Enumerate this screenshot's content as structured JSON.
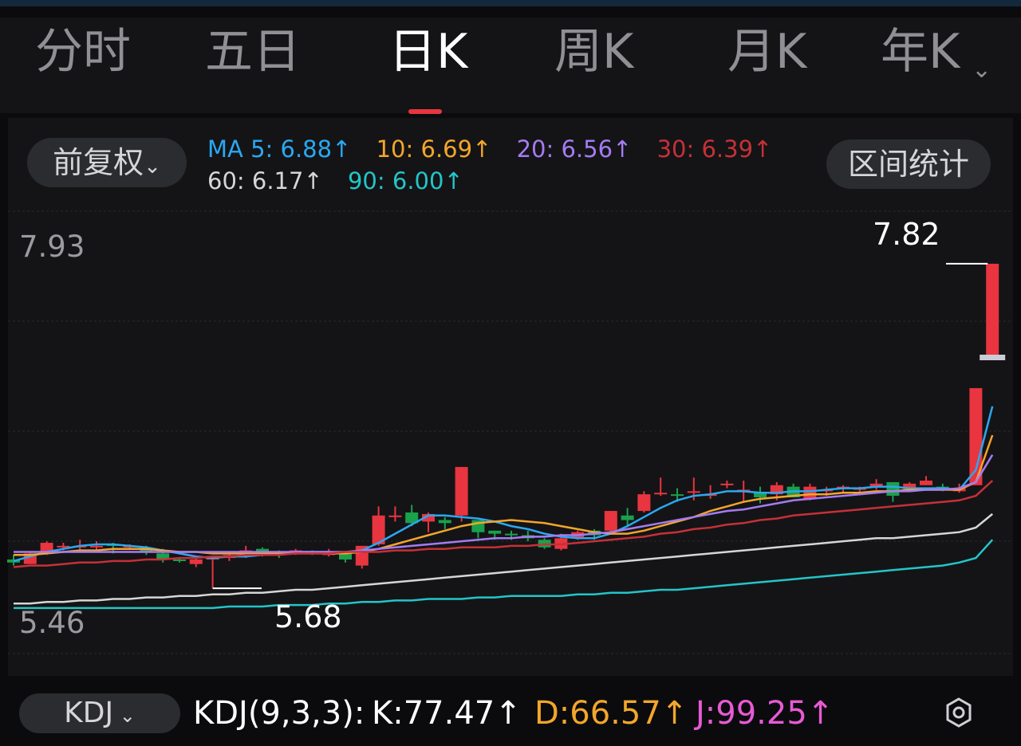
{
  "tabs": [
    {
      "label": "分时",
      "active": false
    },
    {
      "label": "五日",
      "active": false
    },
    {
      "label": "日K",
      "active": true
    },
    {
      "label": "周K",
      "active": false
    },
    {
      "label": "月K",
      "active": false
    },
    {
      "label": "年K",
      "active": false
    }
  ],
  "controls": {
    "adjust_label": "前复权",
    "range_stats_label": "区间统计",
    "indicator_label": "KDJ"
  },
  "ma_legend": [
    {
      "text": "MA 5: 6.88↑",
      "color": "#2aa8f2"
    },
    {
      "text": "10: 6.69↑",
      "color": "#f3a62b"
    },
    {
      "text": "20: 6.56↑",
      "color": "#a57bf2"
    },
    {
      "text": "30: 6.39↑",
      "color": "#c63038"
    },
    {
      "text": "60: 6.17↑",
      "color": "#d6d6d6"
    },
    {
      "text": "90: 6.00↑",
      "color": "#23c5c9"
    }
  ],
  "kdj": {
    "name": "KDJ(9,3,3):",
    "k": {
      "text": "K:77.47↑",
      "color": "#ffffff"
    },
    "d": {
      "text": "D:66.57↑",
      "color": "#f3a62b"
    },
    "j": {
      "text": "J:99.25↑",
      "color": "#e85ad6"
    }
  },
  "colors": {
    "up": "#e8353f",
    "down": "#1aa14c",
    "background": "#141416"
  },
  "chart_data": {
    "type": "candlestick",
    "y_axis_labels": [
      "7.93",
      "5.46"
    ],
    "ylim": [
      5.46,
      7.93
    ],
    "annotations": [
      {
        "text": "7.82",
        "value": 7.82,
        "kind": "high"
      },
      {
        "text": "5.68",
        "value": 5.68,
        "kind": "low"
      }
    ],
    "candles": [
      {
        "o": 5.87,
        "h": 5.9,
        "l": 5.83,
        "c": 5.85
      },
      {
        "o": 5.84,
        "h": 5.92,
        "l": 5.84,
        "c": 5.91
      },
      {
        "o": 5.91,
        "h": 5.99,
        "l": 5.9,
        "c": 5.98
      },
      {
        "o": 5.96,
        "h": 5.98,
        "l": 5.93,
        "c": 5.96
      },
      {
        "o": 5.96,
        "h": 6.0,
        "l": 5.93,
        "c": 5.96
      },
      {
        "o": 5.96,
        "h": 5.99,
        "l": 5.92,
        "c": 5.96
      },
      {
        "o": 5.97,
        "h": 5.98,
        "l": 5.91,
        "c": 5.96
      },
      {
        "o": 5.96,
        "h": 5.97,
        "l": 5.94,
        "c": 5.96
      },
      {
        "o": 5.94,
        "h": 5.96,
        "l": 5.9,
        "c": 5.92
      },
      {
        "o": 5.91,
        "h": 5.94,
        "l": 5.85,
        "c": 5.87
      },
      {
        "o": 5.87,
        "h": 5.88,
        "l": 5.85,
        "c": 5.86
      },
      {
        "o": 5.84,
        "h": 5.88,
        "l": 5.82,
        "c": 5.87
      },
      {
        "o": 5.87,
        "h": 5.89,
        "l": 5.68,
        "c": 5.88
      },
      {
        "o": 5.88,
        "h": 5.92,
        "l": 5.86,
        "c": 5.9
      },
      {
        "o": 5.9,
        "h": 5.96,
        "l": 5.88,
        "c": 5.93
      },
      {
        "o": 5.94,
        "h": 5.95,
        "l": 5.89,
        "c": 5.91
      },
      {
        "o": 5.92,
        "h": 5.93,
        "l": 5.88,
        "c": 5.91
      },
      {
        "o": 5.91,
        "h": 5.94,
        "l": 5.9,
        "c": 5.93
      },
      {
        "o": 5.92,
        "h": 5.93,
        "l": 5.9,
        "c": 5.91
      },
      {
        "o": 5.91,
        "h": 5.94,
        "l": 5.89,
        "c": 5.91
      },
      {
        "o": 5.92,
        "h": 5.92,
        "l": 5.85,
        "c": 5.87
      },
      {
        "o": 5.83,
        "h": 5.96,
        "l": 5.81,
        "c": 5.96
      },
      {
        "o": 5.97,
        "h": 6.22,
        "l": 5.96,
        "c": 6.16
      },
      {
        "o": 6.16,
        "h": 6.22,
        "l": 6.12,
        "c": 6.16
      },
      {
        "o": 6.18,
        "h": 6.23,
        "l": 6.09,
        "c": 6.11
      },
      {
        "o": 6.12,
        "h": 6.18,
        "l": 6.05,
        "c": 6.17
      },
      {
        "o": 6.13,
        "h": 6.15,
        "l": 6.07,
        "c": 6.11
      },
      {
        "o": 6.16,
        "h": 6.48,
        "l": 6.12,
        "c": 6.48
      },
      {
        "o": 6.13,
        "h": 6.13,
        "l": 6.01,
        "c": 6.05
      },
      {
        "o": 6.06,
        "h": 6.06,
        "l": 6.0,
        "c": 6.04
      },
      {
        "o": 6.04,
        "h": 6.06,
        "l": 6.0,
        "c": 6.03
      },
      {
        "o": 6.03,
        "h": 6.06,
        "l": 5.99,
        "c": 6.01
      },
      {
        "o": 6.0,
        "h": 6.01,
        "l": 5.94,
        "c": 5.95
      },
      {
        "o": 5.94,
        "h": 6.04,
        "l": 5.93,
        "c": 6.01
      },
      {
        "o": 6.01,
        "h": 6.06,
        "l": 6.0,
        "c": 6.05
      },
      {
        "o": 6.06,
        "h": 6.07,
        "l": 6.0,
        "c": 6.03
      },
      {
        "o": 6.06,
        "h": 6.19,
        "l": 6.05,
        "c": 6.19
      },
      {
        "o": 6.16,
        "h": 6.21,
        "l": 6.09,
        "c": 6.13
      },
      {
        "o": 6.19,
        "h": 6.32,
        "l": 6.18,
        "c": 6.3
      },
      {
        "o": 6.3,
        "h": 6.41,
        "l": 6.29,
        "c": 6.31
      },
      {
        "o": 6.3,
        "h": 6.34,
        "l": 6.25,
        "c": 6.29
      },
      {
        "o": 6.31,
        "h": 6.41,
        "l": 6.26,
        "c": 6.32
      },
      {
        "o": 6.3,
        "h": 6.36,
        "l": 6.27,
        "c": 6.3
      },
      {
        "o": 6.36,
        "h": 6.39,
        "l": 6.34,
        "c": 6.37
      },
      {
        "o": 6.33,
        "h": 6.39,
        "l": 6.25,
        "c": 6.33
      },
      {
        "o": 6.31,
        "h": 6.35,
        "l": 6.24,
        "c": 6.28
      },
      {
        "o": 6.3,
        "h": 6.38,
        "l": 6.26,
        "c": 6.36
      },
      {
        "o": 6.35,
        "h": 6.37,
        "l": 6.28,
        "c": 6.28
      },
      {
        "o": 6.27,
        "h": 6.37,
        "l": 6.26,
        "c": 6.35
      },
      {
        "o": 6.33,
        "h": 6.35,
        "l": 6.29,
        "c": 6.33
      },
      {
        "o": 6.34,
        "h": 6.36,
        "l": 6.31,
        "c": 6.35
      },
      {
        "o": 6.33,
        "h": 6.35,
        "l": 6.31,
        "c": 6.34
      },
      {
        "o": 6.35,
        "h": 6.4,
        "l": 6.33,
        "c": 6.37
      },
      {
        "o": 6.38,
        "h": 6.38,
        "l": 6.25,
        "c": 6.29
      },
      {
        "o": 6.33,
        "h": 6.38,
        "l": 6.32,
        "c": 6.37
      },
      {
        "o": 6.36,
        "h": 6.42,
        "l": 6.36,
        "c": 6.39
      },
      {
        "o": 6.35,
        "h": 6.37,
        "l": 6.32,
        "c": 6.33
      },
      {
        "o": 6.32,
        "h": 6.37,
        "l": 6.31,
        "c": 6.34
      },
      {
        "o": 6.36,
        "h": 7.0,
        "l": 6.36,
        "c": 7.0
      },
      {
        "o": 7.21,
        "h": 7.82,
        "l": 7.19,
        "c": 7.82
      }
    ],
    "moving_averages": [
      {
        "name": "MA 5",
        "color": "#2aa8f2",
        "values": [
          5.86,
          5.89,
          5.92,
          5.94,
          5.96,
          5.97,
          5.97,
          5.96,
          5.95,
          5.93,
          5.91,
          5.89,
          5.88,
          5.89,
          5.89,
          5.9,
          5.91,
          5.92,
          5.92,
          5.92,
          5.91,
          5.93,
          5.98,
          6.04,
          6.1,
          6.16,
          6.16,
          6.15,
          6.14,
          6.12,
          6.09,
          6.07,
          6.04,
          6.02,
          6.01,
          6.01,
          6.04,
          6.09,
          6.15,
          6.21,
          6.26,
          6.29,
          6.3,
          6.32,
          6.32,
          6.31,
          6.31,
          6.32,
          6.32,
          6.33,
          6.34,
          6.34,
          6.35,
          6.35,
          6.34,
          6.34,
          6.34,
          6.33,
          6.46,
          6.88
        ]
      },
      {
        "name": "10",
        "color": "#f3a62b",
        "values": [
          5.9,
          5.9,
          5.91,
          5.92,
          5.93,
          5.93,
          5.94,
          5.94,
          5.94,
          5.93,
          5.92,
          5.92,
          5.91,
          5.91,
          5.91,
          5.91,
          5.91,
          5.91,
          5.91,
          5.91,
          5.91,
          5.92,
          5.94,
          5.97,
          6.0,
          6.03,
          6.06,
          6.09,
          6.11,
          6.12,
          6.13,
          6.12,
          6.11,
          6.09,
          6.07,
          6.05,
          6.04,
          6.04,
          6.06,
          6.09,
          6.12,
          6.15,
          6.19,
          6.22,
          6.25,
          6.27,
          6.28,
          6.29,
          6.3,
          6.3,
          6.31,
          6.31,
          6.32,
          6.32,
          6.33,
          6.33,
          6.33,
          6.33,
          6.38,
          6.69
        ]
      },
      {
        "name": "20",
        "color": "#a57bf2",
        "values": [
          5.92,
          5.92,
          5.92,
          5.92,
          5.92,
          5.92,
          5.92,
          5.92,
          5.92,
          5.92,
          5.92,
          5.92,
          5.92,
          5.92,
          5.92,
          5.92,
          5.92,
          5.92,
          5.92,
          5.92,
          5.92,
          5.93,
          5.94,
          5.95,
          5.96,
          5.97,
          5.98,
          5.99,
          6.0,
          6.01,
          6.01,
          6.02,
          6.02,
          6.03,
          6.03,
          6.04,
          6.05,
          6.07,
          6.09,
          6.11,
          6.13,
          6.15,
          6.17,
          6.19,
          6.2,
          6.22,
          6.24,
          6.26,
          6.27,
          6.28,
          6.29,
          6.3,
          6.31,
          6.32,
          6.32,
          6.33,
          6.33,
          6.34,
          6.38,
          6.56
        ]
      },
      {
        "name": "30",
        "color": "#c63038",
        "values": [
          5.82,
          5.83,
          5.83,
          5.84,
          5.85,
          5.85,
          5.86,
          5.86,
          5.87,
          5.87,
          5.88,
          5.88,
          5.89,
          5.89,
          5.9,
          5.9,
          5.9,
          5.91,
          5.91,
          5.91,
          5.92,
          5.92,
          5.92,
          5.93,
          5.93,
          5.94,
          5.94,
          5.95,
          5.95,
          5.95,
          5.96,
          5.96,
          5.97,
          5.97,
          5.98,
          5.99,
          6.0,
          6.01,
          6.02,
          6.04,
          6.05,
          6.07,
          6.08,
          6.1,
          6.11,
          6.13,
          6.14,
          6.16,
          6.17,
          6.18,
          6.19,
          6.2,
          6.21,
          6.22,
          6.23,
          6.24,
          6.25,
          6.26,
          6.29,
          6.39
        ]
      },
      {
        "name": "60",
        "color": "#d6d6d6",
        "values": [
          5.58,
          5.58,
          5.59,
          5.59,
          5.6,
          5.6,
          5.61,
          5.61,
          5.62,
          5.62,
          5.63,
          5.63,
          5.64,
          5.64,
          5.65,
          5.65,
          5.66,
          5.67,
          5.67,
          5.68,
          5.69,
          5.7,
          5.71,
          5.72,
          5.73,
          5.74,
          5.75,
          5.76,
          5.77,
          5.78,
          5.79,
          5.8,
          5.81,
          5.82,
          5.83,
          5.84,
          5.85,
          5.86,
          5.87,
          5.88,
          5.89,
          5.9,
          5.91,
          5.92,
          5.93,
          5.94,
          5.95,
          5.96,
          5.97,
          5.98,
          5.99,
          6.0,
          6.01,
          6.01,
          6.02,
          6.03,
          6.04,
          6.05,
          6.08,
          6.17
        ]
      },
      {
        "name": "90",
        "color": "#23c5c9",
        "values": [
          5.55,
          5.55,
          5.55,
          5.55,
          5.55,
          5.55,
          5.55,
          5.55,
          5.55,
          5.55,
          5.55,
          5.55,
          5.55,
          5.56,
          5.56,
          5.56,
          5.57,
          5.57,
          5.57,
          5.58,
          5.58,
          5.59,
          5.59,
          5.6,
          5.6,
          5.61,
          5.61,
          5.61,
          5.62,
          5.62,
          5.63,
          5.63,
          5.63,
          5.63,
          5.64,
          5.64,
          5.65,
          5.65,
          5.66,
          5.67,
          5.67,
          5.68,
          5.69,
          5.7,
          5.71,
          5.72,
          5.73,
          5.74,
          5.75,
          5.76,
          5.77,
          5.78,
          5.79,
          5.8,
          5.81,
          5.82,
          5.83,
          5.85,
          5.88,
          6.0
        ]
      }
    ]
  }
}
